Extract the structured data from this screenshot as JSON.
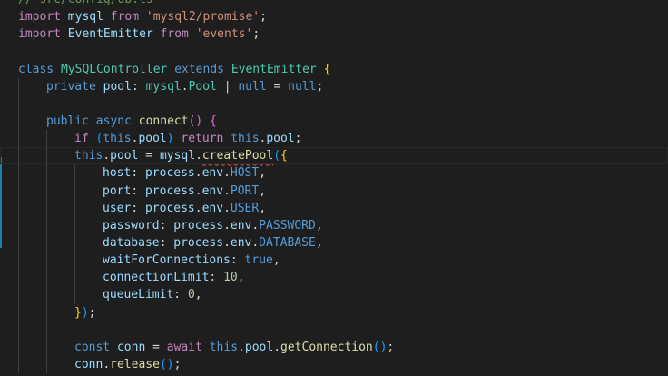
{
  "editor": {
    "lines": [
      {
        "id": "l1",
        "indent": 0,
        "tokens": [
          {
            "t": "// src/config/db.ts",
            "c": "cmt"
          }
        ]
      },
      {
        "id": "l2",
        "indent": 0,
        "tokens": [
          {
            "t": "import",
            "c": "kw"
          },
          {
            "t": " ",
            "c": "punc"
          },
          {
            "t": "mysql",
            "c": "var"
          },
          {
            "t": " ",
            "c": "punc"
          },
          {
            "t": "from",
            "c": "kw"
          },
          {
            "t": " ",
            "c": "punc"
          },
          {
            "t": "'mysql2/promise'",
            "c": "str"
          },
          {
            "t": ";",
            "c": "punc"
          }
        ]
      },
      {
        "id": "l3",
        "indent": 0,
        "tokens": [
          {
            "t": "import",
            "c": "kw"
          },
          {
            "t": " ",
            "c": "punc"
          },
          {
            "t": "EventEmitter",
            "c": "var"
          },
          {
            "t": " ",
            "c": "punc"
          },
          {
            "t": "from",
            "c": "kw"
          },
          {
            "t": " ",
            "c": "punc"
          },
          {
            "t": "'events'",
            "c": "str"
          },
          {
            "t": ";",
            "c": "punc"
          }
        ]
      },
      {
        "id": "l4",
        "indent": 0,
        "tokens": []
      },
      {
        "id": "l5",
        "indent": 0,
        "tokens": [
          {
            "t": "class",
            "c": "st"
          },
          {
            "t": " ",
            "c": "punc"
          },
          {
            "t": "MySQLController",
            "c": "cls"
          },
          {
            "t": " ",
            "c": "punc"
          },
          {
            "t": "extends",
            "c": "st"
          },
          {
            "t": " ",
            "c": "punc"
          },
          {
            "t": "EventEmitter",
            "c": "cls"
          },
          {
            "t": " ",
            "c": "punc"
          },
          {
            "t": "{",
            "c": "br1"
          }
        ]
      },
      {
        "id": "l6",
        "indent": 1,
        "tokens": [
          {
            "t": "private",
            "c": "st"
          },
          {
            "t": " ",
            "c": "punc"
          },
          {
            "t": "pool",
            "c": "var"
          },
          {
            "t": ": ",
            "c": "punc"
          },
          {
            "t": "mysql",
            "c": "cls"
          },
          {
            "t": ".",
            "c": "punc"
          },
          {
            "t": "Pool",
            "c": "cls"
          },
          {
            "t": " | ",
            "c": "punc"
          },
          {
            "t": "null",
            "c": "st"
          },
          {
            "t": " = ",
            "c": "punc"
          },
          {
            "t": "null",
            "c": "st"
          },
          {
            "t": ";",
            "c": "punc"
          }
        ]
      },
      {
        "id": "l7",
        "indent": 1,
        "tokens": []
      },
      {
        "id": "l8",
        "indent": 1,
        "tokens": [
          {
            "t": "public",
            "c": "st"
          },
          {
            "t": " ",
            "c": "punc"
          },
          {
            "t": "async",
            "c": "st"
          },
          {
            "t": " ",
            "c": "punc"
          },
          {
            "t": "connect",
            "c": "fn"
          },
          {
            "t": "()",
            "c": "br2"
          },
          {
            "t": " ",
            "c": "punc"
          },
          {
            "t": "{",
            "c": "br2"
          }
        ]
      },
      {
        "id": "l9",
        "indent": 2,
        "tokens": [
          {
            "t": "if",
            "c": "kw"
          },
          {
            "t": " ",
            "c": "punc"
          },
          {
            "t": "(",
            "c": "br3"
          },
          {
            "t": "this",
            "c": "st"
          },
          {
            "t": ".",
            "c": "punc"
          },
          {
            "t": "pool",
            "c": "var"
          },
          {
            "t": ")",
            "c": "br3"
          },
          {
            "t": " ",
            "c": "punc"
          },
          {
            "t": "return",
            "c": "kw"
          },
          {
            "t": " ",
            "c": "punc"
          },
          {
            "t": "this",
            "c": "st"
          },
          {
            "t": ".",
            "c": "punc"
          },
          {
            "t": "pool",
            "c": "var"
          },
          {
            "t": ";",
            "c": "punc"
          }
        ]
      },
      {
        "id": "l10",
        "indent": 2,
        "current": true,
        "tokens": [
          {
            "t": "this",
            "c": "st"
          },
          {
            "t": ".",
            "c": "punc"
          },
          {
            "t": "pool",
            "c": "var"
          },
          {
            "t": " = ",
            "c": "punc"
          },
          {
            "t": "mysql",
            "c": "var"
          },
          {
            "t": ".",
            "c": "punc"
          },
          {
            "t": "createPool",
            "c": "fn",
            "squiggle": true
          },
          {
            "t": "(",
            "c": "br3"
          },
          {
            "t": "{",
            "c": "br1"
          }
        ]
      },
      {
        "id": "l11",
        "indent": 3,
        "tokens": [
          {
            "t": "host",
            "c": "var"
          },
          {
            "t": ": ",
            "c": "punc"
          },
          {
            "t": "process",
            "c": "var"
          },
          {
            "t": ".",
            "c": "punc"
          },
          {
            "t": "env",
            "c": "var"
          },
          {
            "t": ".",
            "c": "punc"
          },
          {
            "t": "HOST",
            "c": "st"
          },
          {
            "t": ",",
            "c": "punc"
          }
        ]
      },
      {
        "id": "l12",
        "indent": 3,
        "tokens": [
          {
            "t": "port",
            "c": "var"
          },
          {
            "t": ": ",
            "c": "punc"
          },
          {
            "t": "process",
            "c": "var"
          },
          {
            "t": ".",
            "c": "punc"
          },
          {
            "t": "env",
            "c": "var"
          },
          {
            "t": ".",
            "c": "punc"
          },
          {
            "t": "PORT",
            "c": "st"
          },
          {
            "t": ",",
            "c": "punc"
          }
        ]
      },
      {
        "id": "l13",
        "indent": 3,
        "tokens": [
          {
            "t": "user",
            "c": "var"
          },
          {
            "t": ": ",
            "c": "punc"
          },
          {
            "t": "process",
            "c": "var"
          },
          {
            "t": ".",
            "c": "punc"
          },
          {
            "t": "env",
            "c": "var"
          },
          {
            "t": ".",
            "c": "punc"
          },
          {
            "t": "USER",
            "c": "st"
          },
          {
            "t": ",",
            "c": "punc"
          }
        ]
      },
      {
        "id": "l14",
        "indent": 3,
        "tokens": [
          {
            "t": "password",
            "c": "var"
          },
          {
            "t": ": ",
            "c": "punc"
          },
          {
            "t": "process",
            "c": "var"
          },
          {
            "t": ".",
            "c": "punc"
          },
          {
            "t": "env",
            "c": "var"
          },
          {
            "t": ".",
            "c": "punc"
          },
          {
            "t": "PASSWORD",
            "c": "st"
          },
          {
            "t": ",",
            "c": "punc"
          }
        ]
      },
      {
        "id": "l15",
        "indent": 3,
        "tokens": [
          {
            "t": "database",
            "c": "var"
          },
          {
            "t": ": ",
            "c": "punc"
          },
          {
            "t": "process",
            "c": "var"
          },
          {
            "t": ".",
            "c": "punc"
          },
          {
            "t": "env",
            "c": "var"
          },
          {
            "t": ".",
            "c": "punc"
          },
          {
            "t": "DATABASE",
            "c": "st"
          },
          {
            "t": ",",
            "c": "punc"
          }
        ]
      },
      {
        "id": "l16",
        "indent": 3,
        "tokens": [
          {
            "t": "waitForConnections",
            "c": "var"
          },
          {
            "t": ": ",
            "c": "punc"
          },
          {
            "t": "true",
            "c": "st"
          },
          {
            "t": ",",
            "c": "punc"
          }
        ]
      },
      {
        "id": "l17",
        "indent": 3,
        "tokens": [
          {
            "t": "connectionLimit",
            "c": "var"
          },
          {
            "t": ": ",
            "c": "punc"
          },
          {
            "t": "10",
            "c": "num"
          },
          {
            "t": ",",
            "c": "punc"
          }
        ]
      },
      {
        "id": "l18",
        "indent": 3,
        "tokens": [
          {
            "t": "queueLimit",
            "c": "var"
          },
          {
            "t": ": ",
            "c": "punc"
          },
          {
            "t": "0",
            "c": "num"
          },
          {
            "t": ",",
            "c": "punc"
          }
        ]
      },
      {
        "id": "l19",
        "indent": 2,
        "tokens": [
          {
            "t": "}",
            "c": "br1"
          },
          {
            "t": ")",
            "c": "br3"
          },
          {
            "t": ";",
            "c": "punc"
          }
        ]
      },
      {
        "id": "l20",
        "indent": 2,
        "tokens": []
      },
      {
        "id": "l21",
        "indent": 2,
        "tokens": [
          {
            "t": "const",
            "c": "st"
          },
          {
            "t": " ",
            "c": "punc"
          },
          {
            "t": "conn",
            "c": "var"
          },
          {
            "t": " = ",
            "c": "punc"
          },
          {
            "t": "await",
            "c": "kw"
          },
          {
            "t": " ",
            "c": "punc"
          },
          {
            "t": "this",
            "c": "st"
          },
          {
            "t": ".",
            "c": "punc"
          },
          {
            "t": "pool",
            "c": "var"
          },
          {
            "t": ".",
            "c": "punc"
          },
          {
            "t": "getConnection",
            "c": "fn"
          },
          {
            "t": "()",
            "c": "br3"
          },
          {
            "t": ";",
            "c": "punc"
          }
        ]
      },
      {
        "id": "l22",
        "indent": 2,
        "tokens": [
          {
            "t": "conn",
            "c": "var"
          },
          {
            "t": ".",
            "c": "punc"
          },
          {
            "t": "release",
            "c": "fn"
          },
          {
            "t": "()",
            "c": "br3"
          },
          {
            "t": ";",
            "c": "punc"
          }
        ]
      }
    ]
  }
}
